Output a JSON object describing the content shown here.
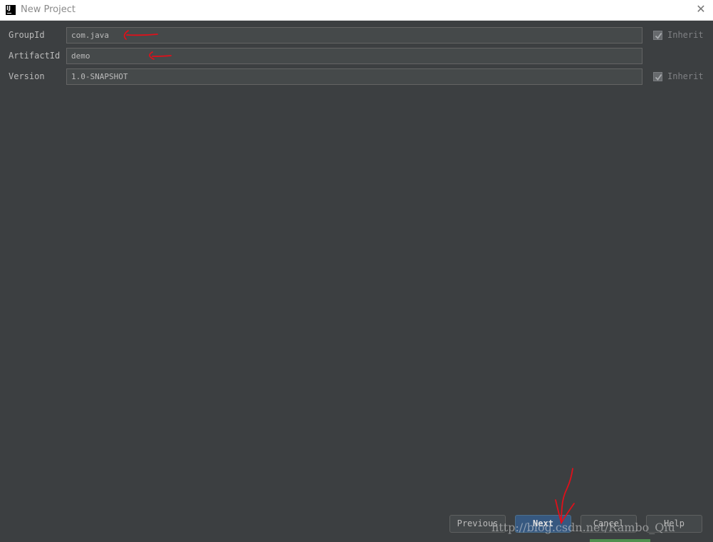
{
  "window": {
    "title": "New Project",
    "app_icon_text": "IJ"
  },
  "form": {
    "group_id": {
      "label": "GroupId",
      "value": "com.java",
      "inherit_label": "Inherit",
      "inherit_checked": true
    },
    "artifact_id": {
      "label": "ArtifactId",
      "value": "demo"
    },
    "version": {
      "label": "Version",
      "value": "1.0-SNAPSHOT",
      "inherit_label": "Inherit",
      "inherit_checked": true
    }
  },
  "buttons": {
    "previous": "Previous",
    "next": "Next",
    "cancel": "Cancel",
    "help": "Help"
  },
  "watermark": "http://blog.csdn.net/Rambo_Qiu",
  "colors": {
    "background": "#3c3f41",
    "field": "#45494a",
    "primary_button": "#365880",
    "annotation": "#e0101a"
  }
}
